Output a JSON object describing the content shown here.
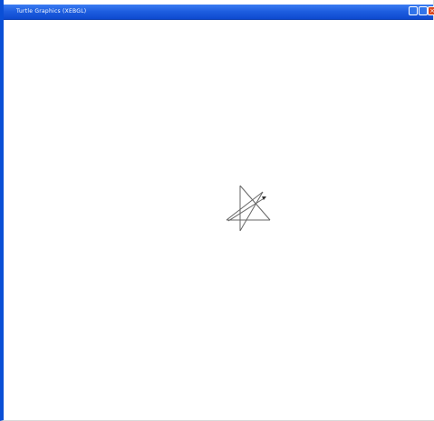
{
  "window": {
    "title": "Turtle Graphics (XEBGL)",
    "controls": {
      "minimize": "",
      "maximize": "",
      "close": "×"
    }
  },
  "colors": {
    "titlebar": "#1f5fe0",
    "border": "#0a4fd6",
    "canvas": "#ffffff",
    "line": "#666666",
    "close": "#d9461f"
  },
  "icons": {
    "minimize": "minimize-icon",
    "maximize": "maximize-icon",
    "close": "close-icon",
    "turtle": "turtle-cursor-icon"
  }
}
